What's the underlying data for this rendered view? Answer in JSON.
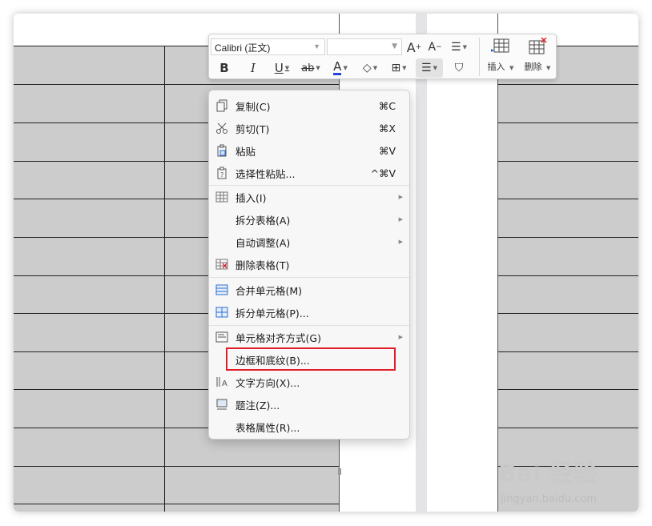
{
  "toolbar": {
    "font_name": "Calibri (正文)",
    "font_size": "",
    "insert_label": "插入",
    "delete_label": "删除",
    "bold_glyph": "B",
    "italic_glyph": "I",
    "underline_glyph": "U",
    "text_color_glyph": "A"
  },
  "context_menu": {
    "items": [
      {
        "label": "复制(C)",
        "shortcut": "⌘C",
        "icon": "copy-icon"
      },
      {
        "label": "剪切(T)",
        "shortcut": "⌘X",
        "icon": "scissors-icon"
      },
      {
        "label": "粘贴",
        "shortcut": "⌘V",
        "icon": "clipboard-icon"
      },
      {
        "label": "选择性粘贴...",
        "shortcut": "^⌘V",
        "icon": "paste-special-icon"
      },
      {
        "label": "插入(I)",
        "icon": "table-insert-icon",
        "submenu": true
      },
      {
        "label": "拆分表格(A)",
        "submenu": true
      },
      {
        "label": "自动调整(A)",
        "submenu": true
      },
      {
        "label": "删除表格(T)",
        "icon": "table-delete-icon"
      },
      {
        "label": "合并单元格(M)",
        "icon": "merge-cells-icon"
      },
      {
        "label": "拆分单元格(P)...",
        "icon": "split-cells-icon"
      },
      {
        "label": "单元格对齐方式(G)",
        "icon": "cell-align-icon",
        "submenu": true
      },
      {
        "label": "边框和底纹(B)..."
      },
      {
        "label": "文字方向(X)...",
        "icon": "text-direction-icon"
      },
      {
        "label": "题注(Z)...",
        "icon": "caption-icon"
      },
      {
        "label": "表格属性(R)..."
      }
    ]
  },
  "watermark": {
    "logo": "Bai 经验",
    "url": "jingyan.baidu.com"
  },
  "colors": {
    "cell_gray": "#cccccc",
    "highlight": "#e11d27",
    "text_color_underline": "#2244dd"
  }
}
